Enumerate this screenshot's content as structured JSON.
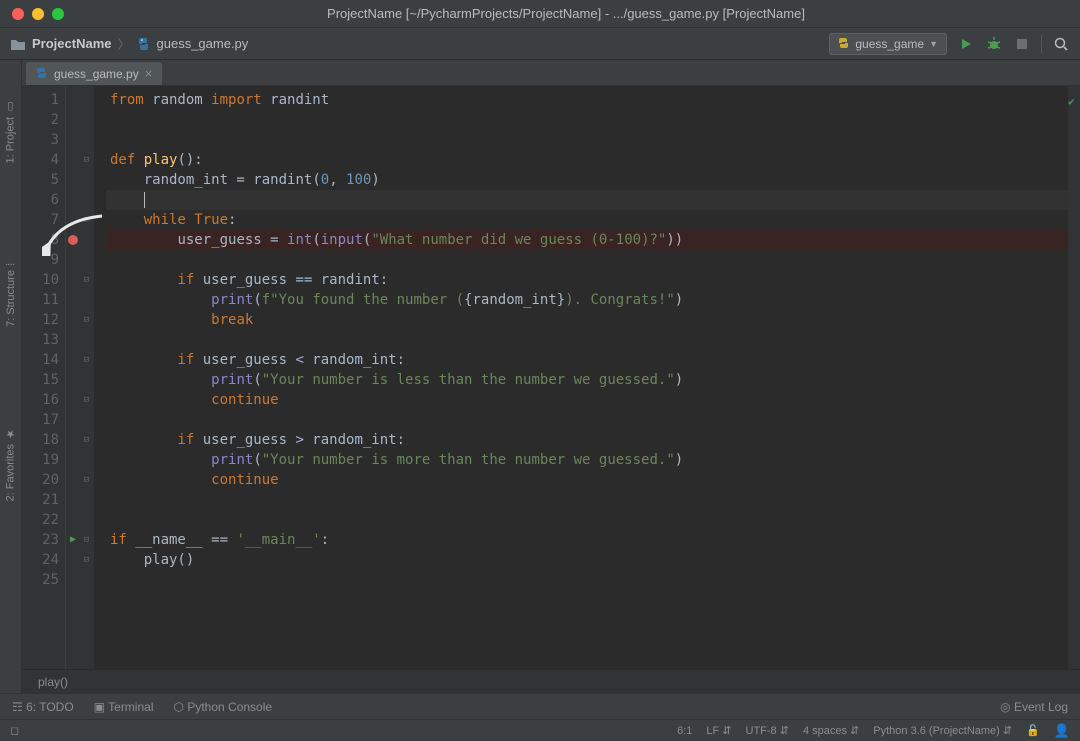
{
  "window": {
    "title": "ProjectName [~/PycharmProjects/ProjectName] - .../guess_game.py [ProjectName]"
  },
  "breadcrumb": {
    "project": "ProjectName",
    "file": "guess_game.py"
  },
  "runConfig": {
    "label": "guess_game"
  },
  "leftTools": {
    "project": "1: Project",
    "structure": "7: Structure",
    "favorites": "2: Favorites"
  },
  "tab": {
    "label": "guess_game.py"
  },
  "code": {
    "lines": [
      {
        "n": 1,
        "html": "<span class='kw'>from</span><span class='id'> random </span><span class='kw'>import</span><span class='id'> randint</span>"
      },
      {
        "n": 2,
        "html": ""
      },
      {
        "n": 3,
        "html": ""
      },
      {
        "n": 4,
        "fold": "⊟",
        "html": "<span class='kw'>def</span> <span class='fn'>play</span><span class='id'>():</span>"
      },
      {
        "n": 5,
        "html": "    <span class='id'>random_int = </span><span class='id'>randint</span><span class='id'>(</span><span class='num'>0</span><span class='id'>, </span><span class='num'>100</span><span class='id'>)</span>"
      },
      {
        "n": 6,
        "current": true,
        "html": "    <span class='caret'></span>"
      },
      {
        "n": 7,
        "fold": "⊟",
        "html": "    <span class='kw'>while </span><span class='kw'>True</span><span class='id'>:</span>"
      },
      {
        "n": 8,
        "bp": true,
        "html": "        <span class='id'>user_guess = </span><span class='builtin'>int</span><span class='id'>(</span><span class='builtin'>input</span><span class='id'>(</span><span class='str'>\"What number did we guess (0-100)?\"</span><span class='id'>))</span>"
      },
      {
        "n": 9,
        "html": ""
      },
      {
        "n": 10,
        "fold": "⊟",
        "html": "        <span class='kw'>if</span><span class='id'> user_guess == randint:</span>"
      },
      {
        "n": 11,
        "html": "            <span class='builtin'>print</span><span class='id'>(</span><span class='str'>f\"You found the number (</span><span class='id'>{random_int}</span><span class='str'>). Congrats!\"</span><span class='id'>)</span>"
      },
      {
        "n": 12,
        "fold": "⊟",
        "html": "            <span class='kw'>break</span>"
      },
      {
        "n": 13,
        "html": ""
      },
      {
        "n": 14,
        "fold": "⊟",
        "html": "        <span class='kw'>if</span><span class='id'> user_guess &lt; random_int:</span>"
      },
      {
        "n": 15,
        "html": "            <span class='builtin'>print</span><span class='id'>(</span><span class='str'>\"Your number is less than the number we guessed.\"</span><span class='id'>)</span>"
      },
      {
        "n": 16,
        "fold": "⊟",
        "html": "            <span class='kw'>continue</span>"
      },
      {
        "n": 17,
        "html": ""
      },
      {
        "n": 18,
        "fold": "⊟",
        "html": "        <span class='kw'>if</span><span class='id'> user_guess &gt; random_int:</span>"
      },
      {
        "n": 19,
        "html": "            <span class='builtin'>print</span><span class='id'>(</span><span class='str'>\"Your number is more than the number we guessed.\"</span><span class='id'>)</span>"
      },
      {
        "n": 20,
        "fold": "⊟",
        "html": "            <span class='kw'>continue</span>"
      },
      {
        "n": 21,
        "html": ""
      },
      {
        "n": 22,
        "html": ""
      },
      {
        "n": 23,
        "run": true,
        "fold": "⊟",
        "html": "<span class='kw'>if</span><span class='id'> __name__ == </span><span class='str'>'__main__'</span><span class='id'>:</span>"
      },
      {
        "n": 24,
        "fold": "⊟",
        "html": "    <span class='id'>play()</span>"
      },
      {
        "n": 25,
        "html": ""
      }
    ],
    "breadcrumb": "play()"
  },
  "bottomTools": {
    "todo": "6: TODO",
    "terminal": "Terminal",
    "pyconsole": "Python Console",
    "eventLog": "Event Log"
  },
  "status": {
    "pos": "6:1",
    "lf": "LF",
    "enc": "UTF-8",
    "indent": "4 spaces",
    "interpreter": "Python 3.6 (ProjectName)"
  }
}
